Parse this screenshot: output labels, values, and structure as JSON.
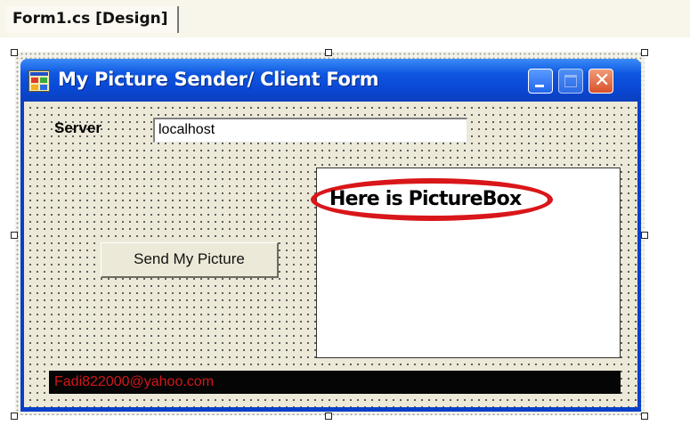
{
  "designer": {
    "tab_label": "Form1.cs [Design]"
  },
  "form": {
    "title": "My Picture Sender/ Client Form",
    "server_label": "Server",
    "server_value": "localhost",
    "send_button_label": "Send My Picture",
    "picturebox_annotation": "Here is PictureBox",
    "footer_text": "Fadi822000@yahoo.com"
  },
  "colors": {
    "titlebar": "#0a48d4",
    "annotation_ellipse": "#d9161a",
    "footer_background": "#050505",
    "footer_text": "#d1161a"
  },
  "icons": [
    "app-form-icon",
    "minimize-icon",
    "maximize-icon",
    "close-icon"
  ]
}
